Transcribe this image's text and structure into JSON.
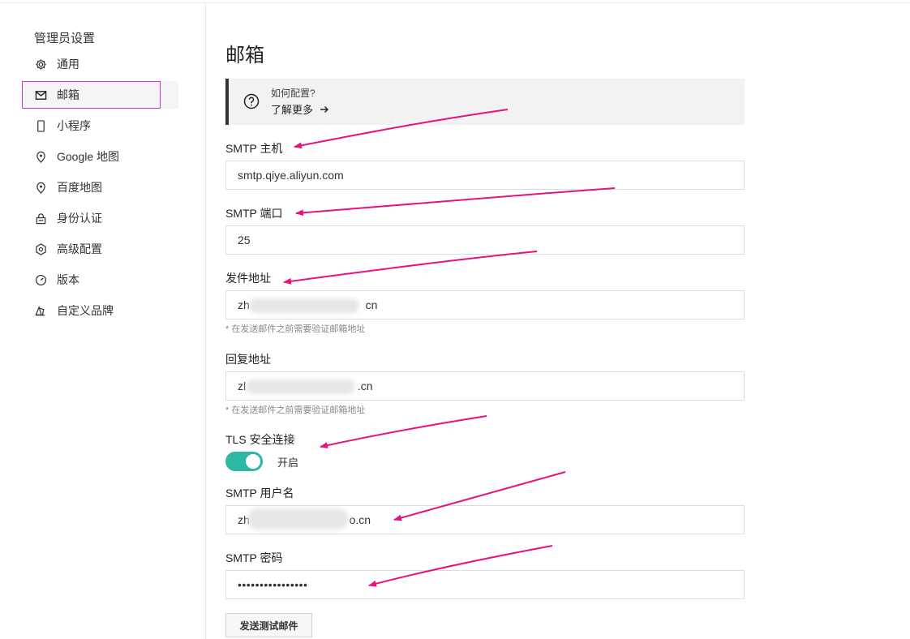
{
  "sidebar": {
    "title": "管理员设置",
    "items": [
      {
        "label": "通用",
        "icon": "gear-icon"
      },
      {
        "label": "邮箱",
        "icon": "mail-icon",
        "active": true
      },
      {
        "label": "小程序",
        "icon": "phone-icon"
      },
      {
        "label": "Google 地图",
        "icon": "map-pin-icon"
      },
      {
        "label": "百度地图",
        "icon": "map-pin-icon"
      },
      {
        "label": "身份认证",
        "icon": "lock-icon"
      },
      {
        "label": "高级配置",
        "icon": "hex-gear-icon"
      },
      {
        "label": "版本",
        "icon": "gauge-icon"
      },
      {
        "label": "自定义品牌",
        "icon": "brand-icon"
      }
    ]
  },
  "main": {
    "title": "邮箱",
    "help": {
      "question": "如何配置?",
      "link": "了解更多"
    },
    "fields": {
      "smtp_host": {
        "label": "SMTP 主机",
        "value": "smtp.qiye.aliyun.com"
      },
      "smtp_port": {
        "label": "SMTP 端口",
        "value": "25"
      },
      "from_address": {
        "label": "发件地址",
        "value_prefix": "zh",
        "value_suffix": "cn",
        "hint": "* 在发送邮件之前需要验证邮箱地址"
      },
      "reply_address": {
        "label": "回复地址",
        "value_prefix": "zl",
        "value_suffix": ".cn",
        "hint": "* 在发送邮件之前需要验证邮箱地址"
      },
      "tls": {
        "label": "TLS 安全连接",
        "state": "开启",
        "enabled": true
      },
      "smtp_user": {
        "label": "SMTP 用户名",
        "value_prefix": "zh",
        "value_suffix": "o.cn"
      },
      "smtp_password": {
        "label": "SMTP 密码",
        "value": "••••••••••••••••"
      }
    },
    "send_test_button": "发送测试邮件"
  },
  "colors": {
    "accent": "#2cb8a3",
    "annotation": "#e8127c",
    "highlight_border": "#d82fd0"
  }
}
